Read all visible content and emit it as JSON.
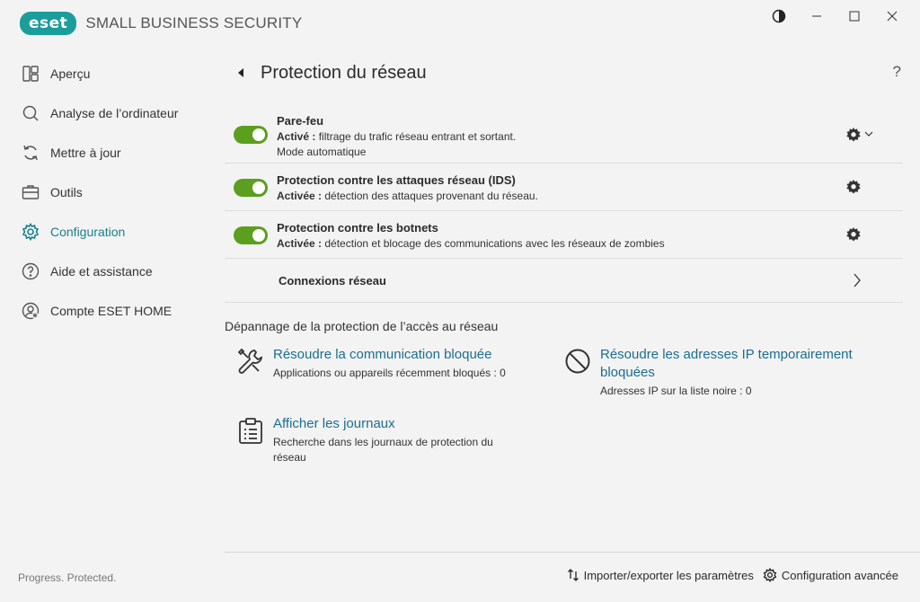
{
  "app": {
    "logo_text": "eset",
    "product_name": "SMALL BUSINESS SECURITY",
    "status": "Progress. Protected."
  },
  "colors": {
    "accent": "#1b9d9b",
    "toggle_on": "#5c9e1e",
    "link": "#1b6e8f"
  },
  "window": {
    "controls": [
      "contrast-icon",
      "minimize-icon",
      "maximize-icon",
      "close-icon"
    ]
  },
  "sidebar": {
    "items": [
      {
        "label": "Aperçu",
        "icon": "dashboard-icon",
        "active": false
      },
      {
        "label": "Analyse de l’ordinateur",
        "icon": "search-icon",
        "active": false
      },
      {
        "label": "Mettre à jour",
        "icon": "refresh-icon",
        "active": false
      },
      {
        "label": "Outils",
        "icon": "toolbox-icon",
        "active": false
      },
      {
        "label": "Configuration",
        "icon": "gear-icon",
        "active": true
      },
      {
        "label": "Aide et assistance",
        "icon": "help-icon",
        "active": false
      },
      {
        "label": "Compte ESET HOME",
        "icon": "account-icon",
        "active": false
      }
    ]
  },
  "main": {
    "title": "Protection du réseau",
    "help": "?",
    "modules": [
      {
        "title": "Pare-feu",
        "status_label": "Activé :",
        "status_text": "filtrage du trafic réseau entrant et sortant.",
        "extra": "Mode automatique",
        "enabled": true
      },
      {
        "title": "Protection contre les attaques réseau (IDS)",
        "status_label": "Activée :",
        "status_text": "détection des attaques provenant du réseau.",
        "enabled": true
      },
      {
        "title": "Protection contre les botnets",
        "status_label": "Activée :",
        "status_text": "détection et blocage des communications avec les réseaux de zombies",
        "enabled": true
      }
    ],
    "network_connections": "Connexions réseau",
    "troubleshoot": {
      "title": "Dépannage de la protection de l’accès au réseau",
      "actions": [
        {
          "link": "Résoudre la communication bloquée",
          "desc": "Applications ou appareils récemment bloqués : 0",
          "icon": "tools-icon"
        },
        {
          "link": "Résoudre les adresses IP temporairement bloquées",
          "desc": "Adresses IP sur la liste noire : 0",
          "icon": "blocked-icon"
        },
        {
          "link": "Afficher les journaux",
          "desc": "Recherche dans les journaux de protection du réseau",
          "icon": "clipboard-icon"
        }
      ]
    }
  },
  "footer": {
    "import_export": "Importer/exporter les paramètres",
    "advanced": "Configuration avancée"
  }
}
